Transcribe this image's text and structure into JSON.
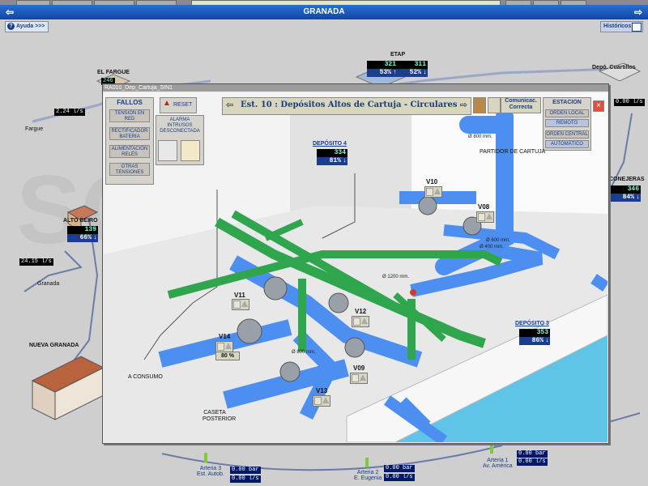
{
  "window": {
    "title": "GRANADA",
    "help_label": "Ayuda >>>",
    "history_label": "Históricos"
  },
  "overview": {
    "el_fargue": {
      "label": "EL FARGUE",
      "level": "246",
      "flow": "2.24 l/s",
      "place": "Fargue"
    },
    "etap": {
      "label": "ETAP",
      "levels": [
        "321",
        "311"
      ],
      "percents": [
        "53%",
        "52%"
      ]
    },
    "depo_cuartillos": {
      "label": "Depó. Cuartillos",
      "flow": "0.00 l/s"
    },
    "conejeras": {
      "label": "CONEJERAS",
      "level": "346",
      "percent": "84%"
    },
    "alto_beiro": {
      "label": "ALTO BEIRO",
      "level": "139",
      "percent": "66%",
      "flow": "24.15 l/s",
      "place": "Granada"
    },
    "nueva_granada": {
      "label": "NUEVA GRANADA"
    },
    "arteria3": {
      "label": "Arteria 3",
      "sublabel": "Est. Autob.",
      "pressure": "0.00 bar",
      "flow": "0.00 l/s"
    },
    "arteria2": {
      "label": "Arteria 2",
      "sublabel": "E. Eugenia",
      "pressure": "0.00 bar",
      "flow": "0.00 l/s"
    },
    "arteria1": {
      "label": "Arteria 1",
      "sublabel": "Av. América",
      "pressure": "0.00 bar",
      "flow": "0.00 l/s"
    }
  },
  "popup": {
    "title": "RA010_Dep_Cartuja_SIN1",
    "station_title": "Est. 10 : Depósitos Altos de Cartuja - Circulares",
    "comm_status": "Comunicac. Correcta",
    "faults": {
      "header": "FALLOS",
      "items": [
        "TENSIÓN EN RED",
        "RECTIFICADOR BATERIA",
        "ALIMENTACIÓN RELÉS",
        "OTRAS TENSIONES"
      ]
    },
    "reset_label": "RESET",
    "alarm": "ALARMA INTRUSOS DESCONECTADA",
    "station": {
      "header": "ESTACION",
      "items": [
        "ORDEN LOCAL",
        "REMOTO",
        "ORDEN CENTRAL",
        "AUTOMÁTICO"
      ]
    },
    "deposito4": {
      "label": "DEPÓSITO 4",
      "level": "334",
      "percent": "81%"
    },
    "deposito3": {
      "label": "DEPÓSITO 3",
      "level": "353",
      "percent": "86%"
    },
    "partidor": "PARTIDOR DE CARTUJA",
    "a_consumo": "A CONSUMO",
    "caseta": "CASETA POSTERIOR",
    "valves": [
      "V10",
      "V08",
      "V11",
      "V12",
      "V14",
      "V09",
      "V13"
    ],
    "v14_percent": "80 %",
    "pipe_diams": [
      "Ø 800 mm.",
      "Ø 600 mm.",
      "Ø 400 mm.",
      "Ø 1200 mm.",
      "Ø 800 mm."
    ]
  },
  "colors": {
    "title_bar": "#1a55b8",
    "pipe_blue": "#4d8ff0",
    "pipe_green": "#2fa64d",
    "water": "#5fc4e8"
  }
}
